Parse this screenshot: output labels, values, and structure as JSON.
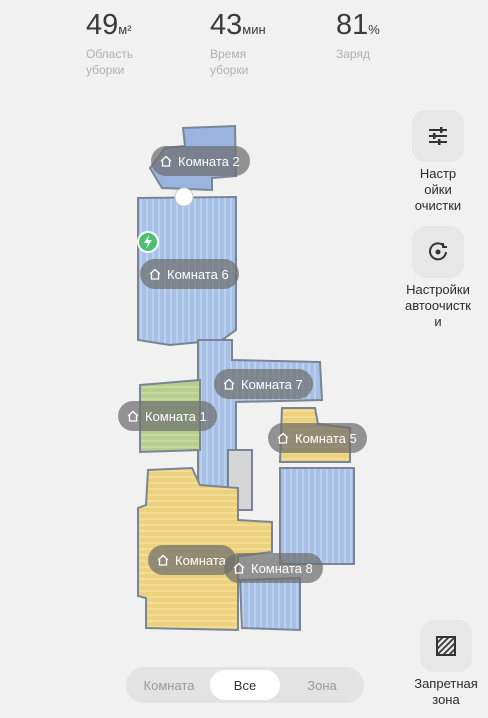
{
  "stats": [
    {
      "value": "49",
      "unit": "м²",
      "label": "Область\nуборки"
    },
    {
      "value": "43",
      "unit": "мин",
      "label": "Время\nуборки"
    },
    {
      "value": "81",
      "unit": "%",
      "label": "Заряд"
    }
  ],
  "rooms": {
    "r2": "Комната 2",
    "r6": "Комната 6",
    "r7": "Комната 7",
    "r1": "Комната 1",
    "r5": "Комната 5",
    "r3": "Комната",
    "r8": "Комната 8"
  },
  "side": {
    "settings_label": "Настр\nойки\nочистки",
    "auto_label": "Настройки\nавтоочистк\nи",
    "nogo_label": "Запретная\nзона"
  },
  "segment": {
    "room": "Комната",
    "all": "Все",
    "zone": "Зона"
  },
  "colors": {
    "blue": "#a6c0e6",
    "yellow": "#ecd27c",
    "green": "#b6cf8e",
    "wall": "#7b8494"
  },
  "icons": [
    "home-icon",
    "sliders-icon",
    "auto-clean-icon",
    "no-go-zone-icon",
    "charging-dock-icon"
  ]
}
